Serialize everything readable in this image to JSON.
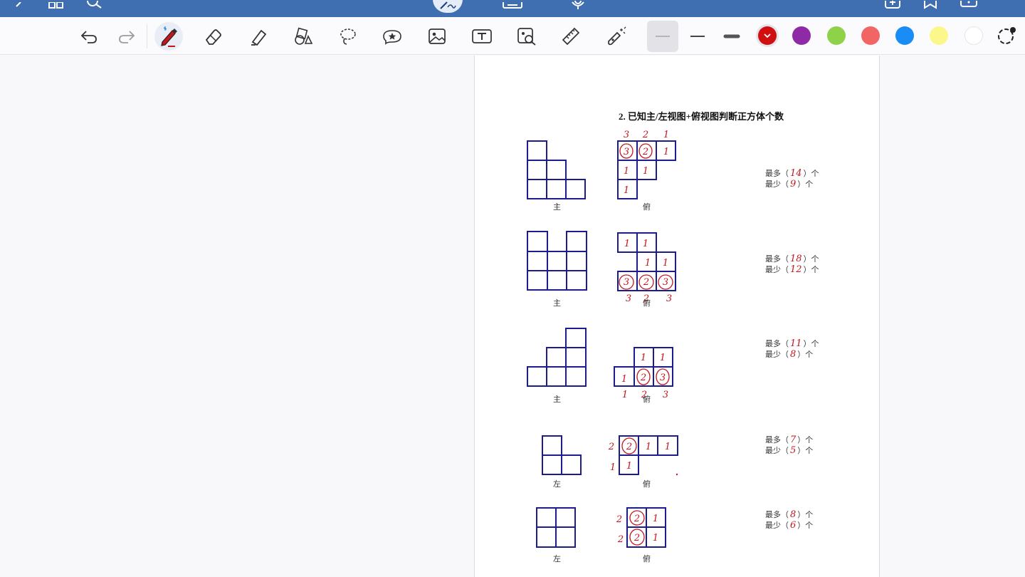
{
  "colors": {
    "bar": "#3f6fb0",
    "grid": "#1c1c8c",
    "ink": "#c4161c"
  },
  "topbar": {
    "icons": [
      "back-icon",
      "grid-view-icon",
      "search-icon",
      "pen-mode-icon",
      "keyboard-icon",
      "microphone-icon",
      "add-page-icon",
      "bookmark-icon",
      "more-icon"
    ]
  },
  "toolbar": {
    "tools": [
      "undo-icon",
      "redo-icon",
      "pen-icon",
      "eraser-icon",
      "highlighter-icon",
      "shapes-icon",
      "lasso-icon",
      "sticker-icon",
      "image-icon",
      "text-icon",
      "image-search-icon",
      "ruler-icon",
      "laser-pointer-icon"
    ],
    "stroke_widths": [
      "thin",
      "medium",
      "thick"
    ],
    "palette": [
      "#d01010",
      "#8e2aa6",
      "#8ed24a",
      "#f26565",
      "#1a8cf5",
      "#fbf78a",
      "#ffffff"
    ],
    "selected_color": "#d01010"
  },
  "document": {
    "title": "2.  已知主/左视图+俯视图判断正方体个数",
    "problems": [
      {
        "front_label": "主",
        "top_label": "俯",
        "max_prefix": "最多（",
        "max_value": "14",
        "min_prefix": "最少（",
        "min_value": "9",
        "suffix": "）个",
        "top_numbers": [
          "3",
          "2",
          "1"
        ],
        "cells": [
          "3",
          "2",
          "1",
          "1",
          "1",
          "1"
        ]
      },
      {
        "front_label": "主",
        "top_label": "俯",
        "max_prefix": "最多（",
        "max_value": "18",
        "min_prefix": "最少（",
        "min_value": "12",
        "suffix": "）个",
        "bottom_numbers": [
          "3",
          "2",
          "3"
        ],
        "cells": [
          "1",
          "1",
          "1",
          "1",
          "3",
          "2",
          "3"
        ]
      },
      {
        "front_label": "主",
        "top_label": "俯",
        "max_prefix": "最多（",
        "max_value": "11",
        "min_prefix": "最少（",
        "min_value": "8",
        "suffix": "）个",
        "bottom_numbers": [
          "1",
          "2",
          "3"
        ],
        "cells": [
          "1",
          "1",
          "1",
          "2",
          "3"
        ]
      },
      {
        "front_label": "左",
        "top_label": "俯",
        "max_prefix": "最多（",
        "max_value": "7",
        "min_prefix": "最少（",
        "min_value": "5",
        "suffix": "）个",
        "side_numbers": [
          "2",
          "1"
        ],
        "cells": [
          "2",
          "1",
          "1",
          "1"
        ]
      },
      {
        "front_label": "左",
        "top_label": "俯",
        "max_prefix": "最多（",
        "max_value": "8",
        "min_prefix": "最少（",
        "min_value": "6",
        "suffix": "）个",
        "side_numbers": [
          "2",
          "2"
        ],
        "cells": [
          "2",
          "1",
          "2",
          "1"
        ]
      }
    ]
  }
}
